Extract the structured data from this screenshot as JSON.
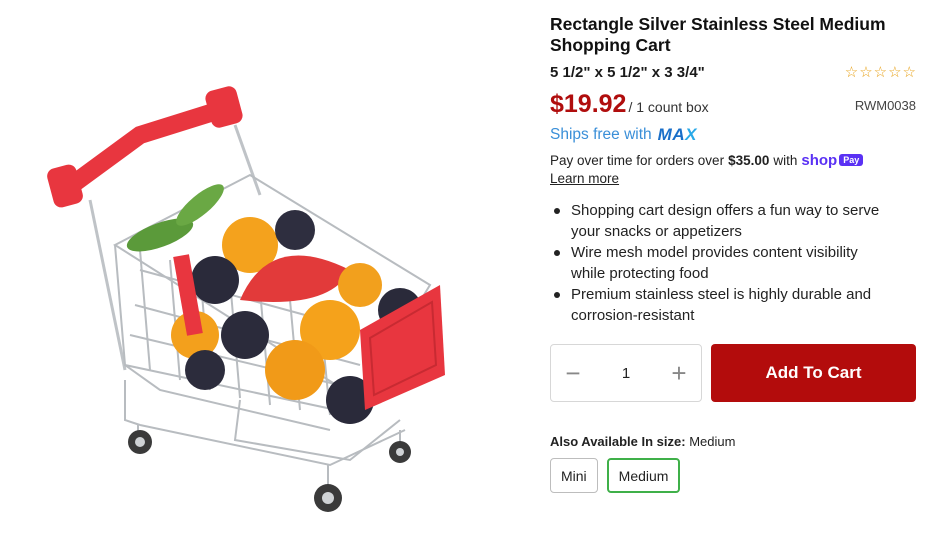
{
  "product": {
    "title": "Rectangle Silver Stainless Steel Medium Shopping Cart",
    "dimensions": "5 1/2\" x 5 1/2\" x 3 3/4\"",
    "rating_stars": 0,
    "rating_max": 5,
    "price": "$19.92",
    "unit": "/ 1 count box",
    "sku": "RWM0038",
    "image_icon": "mini-shopping-cart-with-fruit"
  },
  "shipping": {
    "text": "Ships free with",
    "logo_prefix": "MA",
    "logo_x": "X"
  },
  "payment": {
    "prefix": "Pay over time for orders over",
    "amount": "$35.00",
    "with": "with",
    "shop_logo": "shop",
    "pay_badge": "Pay",
    "learn_more": "Learn more"
  },
  "features": [
    "Shopping cart design offers a fun way to serve your snacks or appetizers",
    "Wire mesh model provides content visibility while protecting food",
    "Premium stainless steel is highly durable and corrosion-resistant"
  ],
  "purchase": {
    "quantity": "1",
    "minus_icon": "minus-icon",
    "plus_icon": "plus-icon",
    "add_to_cart": "Add To Cart"
  },
  "sizes": {
    "label": "Also Available In size:",
    "current": "Medium",
    "options": [
      "Mini",
      "Medium"
    ],
    "selected_index": 1
  },
  "colors": {
    "price_red": "#b00d0d",
    "button_red": "#b30c0c",
    "selected_green": "#3fb049",
    "star_gold": "#e8a31c",
    "ships_blue": "#3a8fd8",
    "shop_purple": "#5a31f4"
  }
}
